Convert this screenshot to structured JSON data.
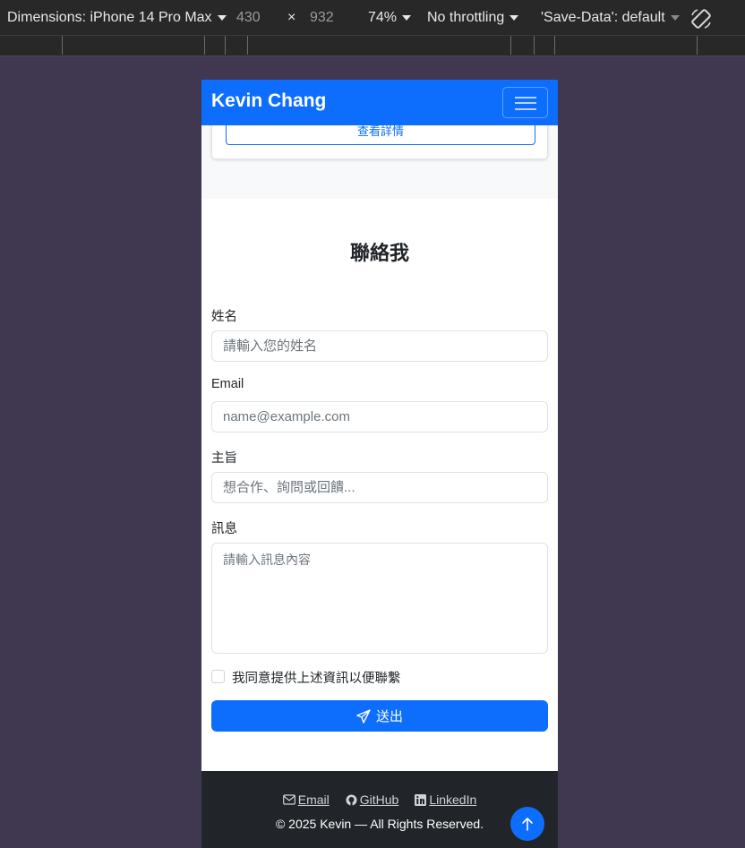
{
  "devtools": {
    "dimensions_label": "Dimensions: iPhone 14 Pro Max",
    "width_value": "430",
    "times": "×",
    "height_value": "932",
    "zoom": "74%",
    "throttling": "No throttling",
    "save_data": "'Save-Data': default"
  },
  "navbar": {
    "brand": "Kevin Chang"
  },
  "project_card": {
    "detail_button": "查看詳情"
  },
  "contact": {
    "title": "聯絡我",
    "name_label": "姓名",
    "name_placeholder": "請輸入您的姓名",
    "email_label": "Email",
    "email_placeholder": "name@example.com",
    "subject_label": "主旨",
    "subject_placeholder": "想合作、詢問或回饋...",
    "message_label": "訊息",
    "message_placeholder": "請輸入訊息內容",
    "consent_label": "我同意提供上述資訊以便聯繫",
    "submit_label": "送出"
  },
  "footer": {
    "links": [
      {
        "label": "Email",
        "icon": "envelope-icon"
      },
      {
        "label": "GitHub",
        "icon": "github-icon"
      },
      {
        "label": "LinkedIn",
        "icon": "linkedin-icon"
      }
    ],
    "copyright": "© 2025 Kevin — All Rights Reserved."
  },
  "colors": {
    "primary": "#0d6efd",
    "footer_bg": "#212529",
    "section_bg": "#f8f9fa",
    "page_bg": "#3f3850"
  }
}
